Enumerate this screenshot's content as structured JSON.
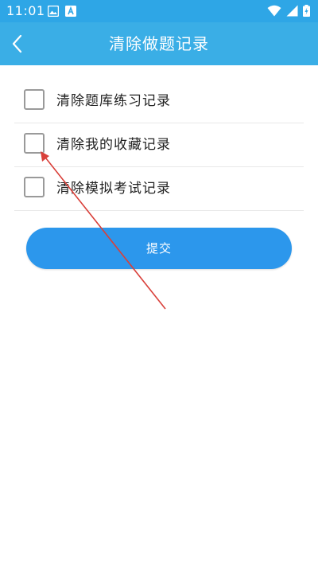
{
  "status_bar": {
    "time": "11:01",
    "left_icons": [
      "image-icon",
      "font-app-icon"
    ],
    "right_icons": [
      "wifi-icon",
      "cellular-signal-icon",
      "battery-charging-icon"
    ]
  },
  "header": {
    "back_icon": "chevron-left-icon",
    "title": "清除做题记录",
    "background": "#3aaee6"
  },
  "options": [
    {
      "label": "清除题库练习记录",
      "checked": false
    },
    {
      "label": "清除我的收藏记录",
      "checked": false
    },
    {
      "label": "清除模拟考试记录",
      "checked": false
    }
  ],
  "submit": {
    "label": "提交",
    "background": "#2c97ec"
  },
  "annotation": {
    "type": "arrow",
    "color": "#d9403a",
    "target": "清除我的收藏记录"
  }
}
